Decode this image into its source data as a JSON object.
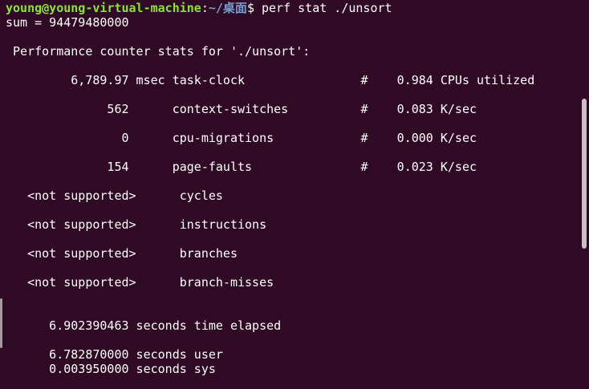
{
  "terminal": {
    "prompt": {
      "user_host": "young@young-virtual-machine",
      "separator": ":",
      "path": "~/桌面",
      "symbol": "$ ",
      "command": "perf stat ./unsort"
    },
    "output_sum": "sum = 94479480000",
    "header": " Performance counter stats for './unsort':",
    "stats": [
      "         6,789.97 msec task-clock                #    0.984 CPUs utilized",
      "              562      context-switches          #    0.083 K/sec",
      "                0      cpu-migrations            #    0.000 K/sec",
      "              154      page-faults               #    0.023 K/sec",
      "   <not supported>      cycles",
      "   <not supported>      instructions",
      "   <not supported>      branches",
      "   <not supported>      branch-misses"
    ],
    "elapsed": "      6.902390463 seconds time elapsed",
    "user": "      6.782870000 seconds user",
    "sys": "      0.003950000 seconds sys"
  },
  "colors": {
    "background": "#300a24",
    "prompt_user_host": "#8ae234",
    "prompt_path": "#729fcf",
    "text": "#ffffff"
  }
}
